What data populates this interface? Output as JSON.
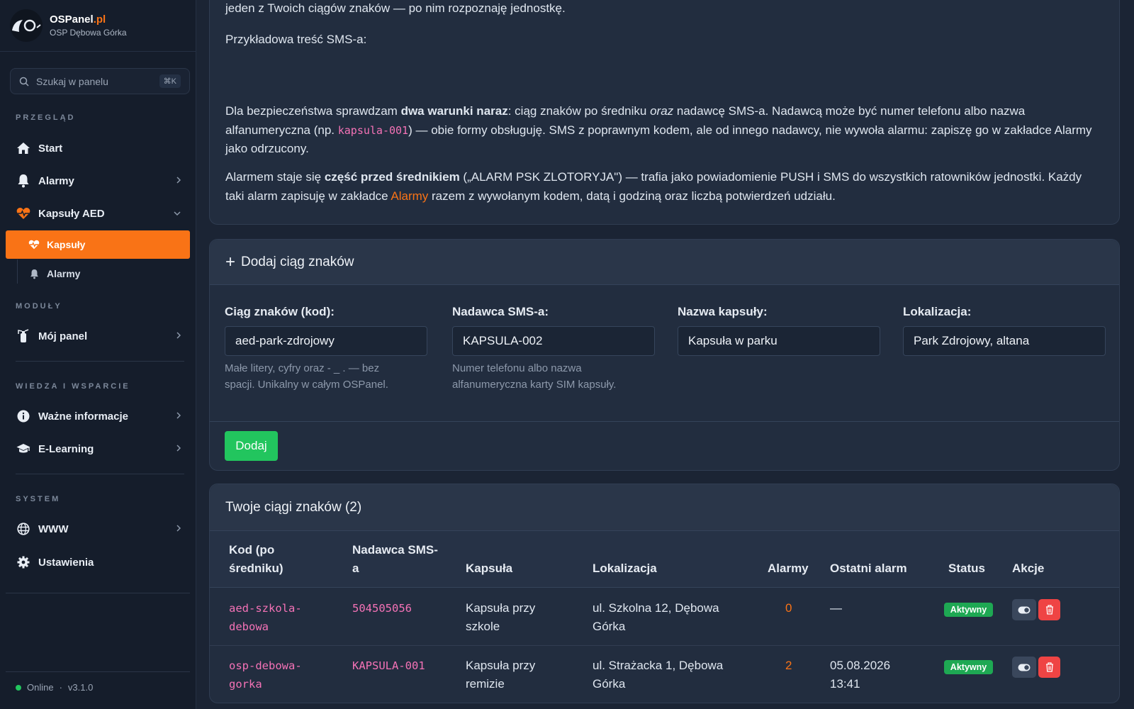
{
  "brand": {
    "name": "OSPanel",
    "tld": ".pl",
    "unit": "OSP Dębowa Górka"
  },
  "search": {
    "placeholder": "Szukaj w panelu",
    "shortcut": "⌘K"
  },
  "sidebar": {
    "section_overview": "PRZEGLĄD",
    "start": "Start",
    "alarms": "Alarmy",
    "capsules_aed": "Kapsuły AED",
    "sub_capsules": "Kapsuły",
    "sub_alarms": "Alarmy",
    "section_modules": "MODUŁY",
    "my_panel": "Mój panel",
    "section_knowledge": "WIEDZA I WSPARCIE",
    "important_info": "Ważne informacje",
    "elearning": "E-Learning",
    "section_system": "SYSTEM",
    "www": "WWW",
    "settings": "Ustawienia",
    "status": "Online",
    "sep": "·",
    "version": "v3.1.0"
  },
  "info": {
    "line0": "jeden z Twoich ciągów znaków — po nim rozpoznaję jednostkę.",
    "example_label": "Przykładowa treść SMS-a:",
    "p1_a": "Dla bezpieczeństwa sprawdzam ",
    "p1_b": "dwa warunki naraz",
    "p1_c": ": ciąg znaków po średniku ",
    "p1_d": "oraz",
    "p1_e": " nadawcę SMS-a. Nadawcą może być numer telefonu albo nazwa alfanumeryczna (np. ",
    "p1_code": "kapsula-001",
    "p1_f": ") — obie formy obsługuję. SMS z poprawnym kodem, ale od innego nadawcy, nie wywoła alarmu: zapiszę go w zakładce Alarmy jako odrzucony.",
    "p2_a": "Alarmem staje się ",
    "p2_b": "część przed średnikiem",
    "p2_c": " („ALARM PSK ZLOTORYJA\") — trafia jako powiadomienie PUSH i SMS do wszystkich ratowników jednostki. Każdy taki alarm zapisuję w zakładce ",
    "p2_link": "Alarmy",
    "p2_d": " razem z wywołanym kodem, datą i godziną oraz liczbą potwierdzeń udziału."
  },
  "form": {
    "title": "Dodaj ciąg znaków",
    "code_label": "Ciąg znaków (kod):",
    "code_value": "aed-park-zdrojowy",
    "code_help": "Małe litery, cyfry oraz - _ . — bez spacji. Unikalny w całym OSPanel.",
    "sender_label": "Nadawca SMS-a:",
    "sender_value": "KAPSULA-002",
    "sender_help": "Numer telefonu albo nazwa alfanumeryczna karty SIM kapsuły.",
    "name_label": "Nazwa kapsuły:",
    "name_value": "Kapsuła w parku",
    "loc_label": "Lokalizacja:",
    "loc_value": "Park Zdrojowy, altana",
    "submit": "Dodaj"
  },
  "table": {
    "title": "Twoje ciągi znaków (2)",
    "headers": {
      "code_1": "Kod (po",
      "code_2": "średniku)",
      "sender_1": "Nadawca SMS-",
      "sender_2": "a",
      "capsule": "Kapsuła",
      "location": "Lokalizacja",
      "alarms": "Alarmy",
      "last": "Ostatni alarm",
      "status": "Status",
      "actions": "Akcje"
    },
    "rows": [
      {
        "code_1": "aed-szkola-",
        "code_2": "debowa",
        "sender": "504505056",
        "capsule_1": "Kapsuła przy",
        "capsule_2": "szkole",
        "loc_1": "ul. Szkolna 12, Dębowa",
        "loc_2": "Górka",
        "alarms": "0",
        "last_1": "—",
        "last_2": "",
        "status": "Aktywny"
      },
      {
        "code_1": "osp-debowa-",
        "code_2": "gorka",
        "sender": "KAPSULA-001",
        "capsule_1": "Kapsuła przy",
        "capsule_2": "remizie",
        "loc_1": "ul. Strażacka 1, Dębowa",
        "loc_2": "Górka",
        "alarms": "2",
        "last_1": "05.08.2026",
        "last_2": "13:41",
        "status": "Aktywny"
      }
    ]
  },
  "colors": {
    "accent": "#f97316",
    "success": "#22c55e",
    "danger": "#ef4444",
    "code": "#f472b6"
  }
}
